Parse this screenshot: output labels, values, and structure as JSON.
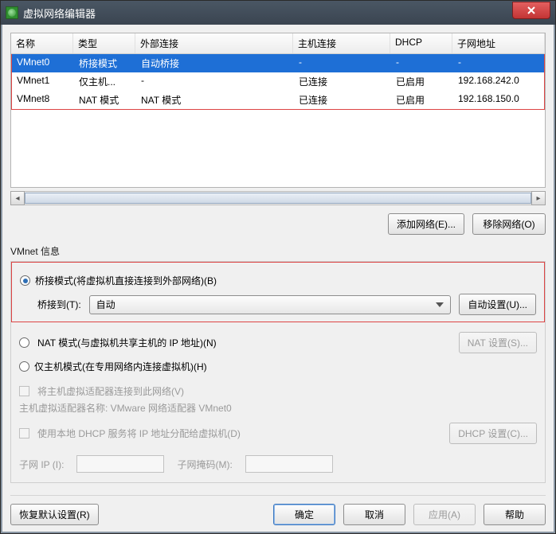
{
  "window": {
    "title": "虚拟网络编辑器"
  },
  "table": {
    "headers": {
      "name": "名称",
      "type": "类型",
      "external": "外部连接",
      "host": "主机连接",
      "dhcp": "DHCP",
      "subnet": "子网地址"
    },
    "rows": [
      {
        "name": "VMnet0",
        "type": "桥接模式",
        "external": "自动桥接",
        "host": "-",
        "dhcp": "-",
        "subnet": "-"
      },
      {
        "name": "VMnet1",
        "type": "仅主机...",
        "external": "-",
        "host": "已连接",
        "dhcp": "已启用",
        "subnet": "192.168.242.0"
      },
      {
        "name": "VMnet8",
        "type": "NAT 模式",
        "external": "NAT 模式",
        "host": "已连接",
        "dhcp": "已启用",
        "subnet": "192.168.150.0"
      }
    ]
  },
  "buttons": {
    "add_network": "添加网络(E)...",
    "remove_network": "移除网络(O)",
    "auto_settings": "自动设置(U)...",
    "nat_settings": "NAT 设置(S)...",
    "dhcp_settings": "DHCP 设置(C)...",
    "restore_defaults": "恢复默认设置(R)",
    "ok": "确定",
    "cancel": "取消",
    "apply": "应用(A)",
    "help": "帮助"
  },
  "info": {
    "section_title": "VMnet 信息",
    "bridged_label": "桥接模式(将虚拟机直接连接到外部网络)(B)",
    "bridged_to_label": "桥接到(T):",
    "bridged_to_value": "自动",
    "nat_label": "NAT 模式(与虚拟机共享主机的 IP 地址)(N)",
    "hostonly_label": "仅主机模式(在专用网络内连接虚拟机)(H)",
    "host_adapter_checkbox": "将主机虚拟适配器连接到此网络(V)",
    "host_adapter_name_label": "主机虚拟适配器名称: ",
    "host_adapter_name_value": "VMware 网络适配器 VMnet0",
    "dhcp_checkbox": "使用本地 DHCP 服务将 IP 地址分配给虚拟机(D)",
    "subnet_ip_label": "子网 IP (I):",
    "subnet_mask_label": "子网掩码(M):"
  }
}
